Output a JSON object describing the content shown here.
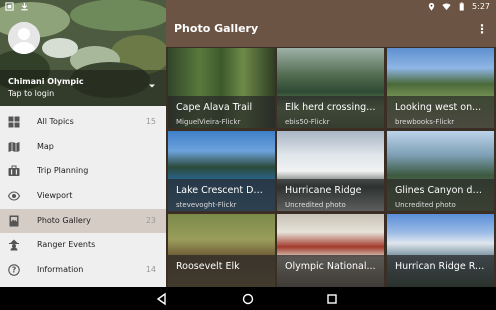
{
  "status_bar": {
    "time": "5:27"
  },
  "app_bar": {
    "title": "Photo Gallery"
  },
  "drawer": {
    "park_name": "Chimani Olympic",
    "login_text": "Tap to login",
    "items": [
      {
        "label": "All Topics",
        "count": "15",
        "icon": "grid-icon"
      },
      {
        "label": "Map",
        "count": "",
        "icon": "map-icon"
      },
      {
        "label": "Trip Planning",
        "count": "",
        "icon": "suitcase-icon"
      },
      {
        "label": "Viewport",
        "count": "",
        "icon": "eye-icon"
      },
      {
        "label": "Photo Gallery",
        "count": "23",
        "icon": "photo-icon",
        "active": true
      },
      {
        "label": "Ranger Events",
        "count": "",
        "icon": "ranger-icon"
      },
      {
        "label": "Information",
        "count": "14",
        "icon": "help-icon"
      }
    ]
  },
  "photos": [
    {
      "title": "Cape Alava Trail",
      "credit": "MiguelVieira-Flickr"
    },
    {
      "title": "Elk herd crossing a...",
      "credit": "ebis50-Flickr"
    },
    {
      "title": "Looking west on...",
      "credit": "brewbooks-Flickr"
    },
    {
      "title": "Lake Crescent Dock",
      "credit": "stevevoght-Flickr"
    },
    {
      "title": "Hurricane Ridge",
      "credit": "Uncredited photo"
    },
    {
      "title": "Glines Canyon dam...",
      "credit": "Uncredited photo"
    },
    {
      "title": "Roosevelt Elk",
      "credit": ""
    },
    {
      "title": "Olympic National...",
      "credit": ""
    },
    {
      "title": "Hurrican Ridge Roa...",
      "credit": ""
    }
  ],
  "colors": {
    "app_bar": "#6b5444",
    "background": "#3a2e25",
    "drawer": "#efefef",
    "active_item": "#d5ccc6"
  }
}
